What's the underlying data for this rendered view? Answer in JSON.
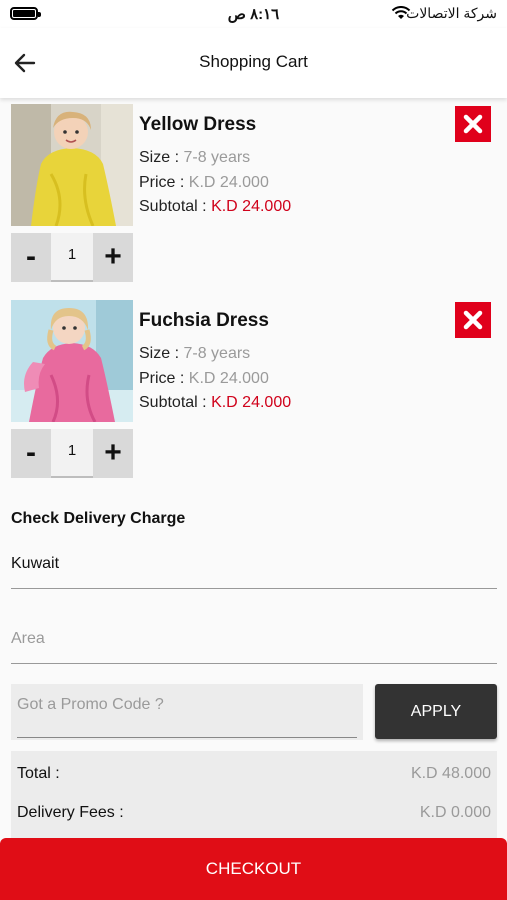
{
  "status_bar": {
    "time": "٨:١٦ ص",
    "carrier": "شركة الاتصالات",
    "icons": [
      "battery-icon",
      "wifi-icon"
    ]
  },
  "nav": {
    "title": "Shopping Cart",
    "back_icon": "arrow-left-icon"
  },
  "cart": {
    "items": [
      {
        "name": "Yellow Dress",
        "size_label": "Size :",
        "size_value": "7-8 years",
        "price_label": "Price :",
        "price_value": "K.D 24.000",
        "subtotal_label": "Subtotal :",
        "subtotal_value": "K.D 24.000",
        "quantity": "1",
        "minus_label": "-",
        "plus_label": "+",
        "image_color": "#e8d43a"
      },
      {
        "name": "Fuchsia Dress",
        "size_label": "Size :",
        "size_value": "7-8 years",
        "price_label": "Price :",
        "price_value": "K.D 24.000",
        "subtotal_label": "Subtotal :",
        "subtotal_value": "K.D 24.000",
        "quantity": "1",
        "minus_label": "-",
        "plus_label": "+",
        "image_color": "#e86a9e"
      }
    ]
  },
  "delivery": {
    "title": "Check Delivery Charge",
    "country_value": "Kuwait",
    "area_placeholder": "Area"
  },
  "promo": {
    "placeholder": "Got a Promo Code ?",
    "apply_label": "APPLY"
  },
  "totals": {
    "total_label": "Total :",
    "total_value": "K.D 48.000",
    "delivery_label": "Delivery Fees :",
    "delivery_value": "K.D 0.000"
  },
  "checkout_label": "CHECKOUT",
  "colors": {
    "accent_red": "#e00d16",
    "remove_red": "#e0001b",
    "price_red": "#d0021b",
    "apply_dark": "#333333"
  }
}
